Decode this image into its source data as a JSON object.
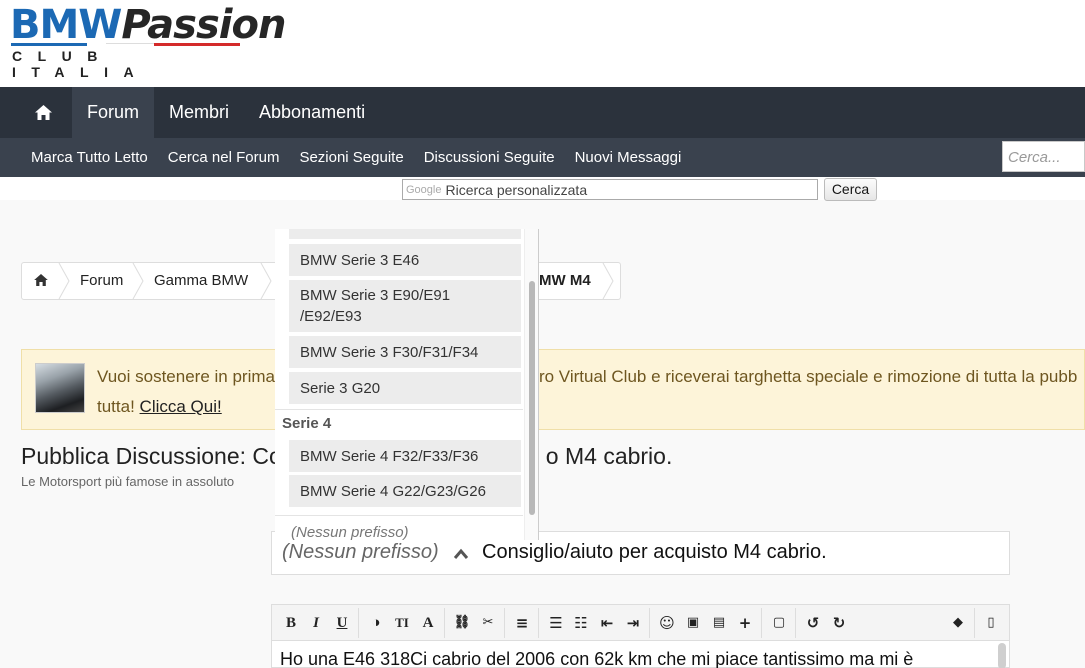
{
  "logo": {
    "brand_a": "BMW",
    "brand_b": "Passion",
    "tagline": "CLUB ITALIA"
  },
  "nav": {
    "tabs": [
      {
        "label": "Forum",
        "active": true
      },
      {
        "label": "Membri"
      },
      {
        "label": "Abbonamenti"
      }
    ]
  },
  "subnav": {
    "items": [
      "Marca Tutto Letto",
      "Cerca nel Forum",
      "Sezioni Seguite",
      "Discussioni Seguite",
      "Nuovi Messaggi"
    ],
    "search_placeholder": "Cerca..."
  },
  "google_search": {
    "brand": "Google",
    "placeholder": "Ricerca personalizzata",
    "button": "Cerca"
  },
  "breadcrumb": {
    "items": [
      "Forum",
      "Gamma BMW",
      "MW M4"
    ]
  },
  "notice": {
    "text_a": "Vuoi sostenere in prima",
    "text_b": "ro Virtual Club e riceverai targhetta speciale e rimozione di tutta la pubb",
    "text_c": "tutta!",
    "link": "Clicca Qui!"
  },
  "page": {
    "title_a": "Pubblica Discussione: Co",
    "title_b": "o M4 cabrio.",
    "desc": "Le Motorsport più famose in assoluto"
  },
  "prefix_dropdown": {
    "options_top": [
      "BMW Serie 3 E46",
      "BMW Serie 3 E90/E91\n/E92/E93",
      "BMW Serie 3 F30/F31/F34",
      "Serie 3 G20"
    ],
    "group": "Serie 4",
    "options_bottom": [
      "BMW Serie 4 F32/F33/F36",
      "BMW Serie 4 G22/G23/G26"
    ],
    "cut_off": "(Nessun prefisso)"
  },
  "thread": {
    "prefix": "(Nessun prefisso)",
    "title": "Consiglio/aiuto per acquisto M4 cabrio."
  },
  "editor": {
    "body_text": "Ho una E46 318Ci cabrio del 2006 con 62k km che mi piace tantissimo ma mi è"
  },
  "colors": {
    "nav": "#2b323c",
    "subnav": "#3a424e",
    "notice_bg": "#fdf4d9",
    "bmw_blue": "#1c69b4"
  }
}
